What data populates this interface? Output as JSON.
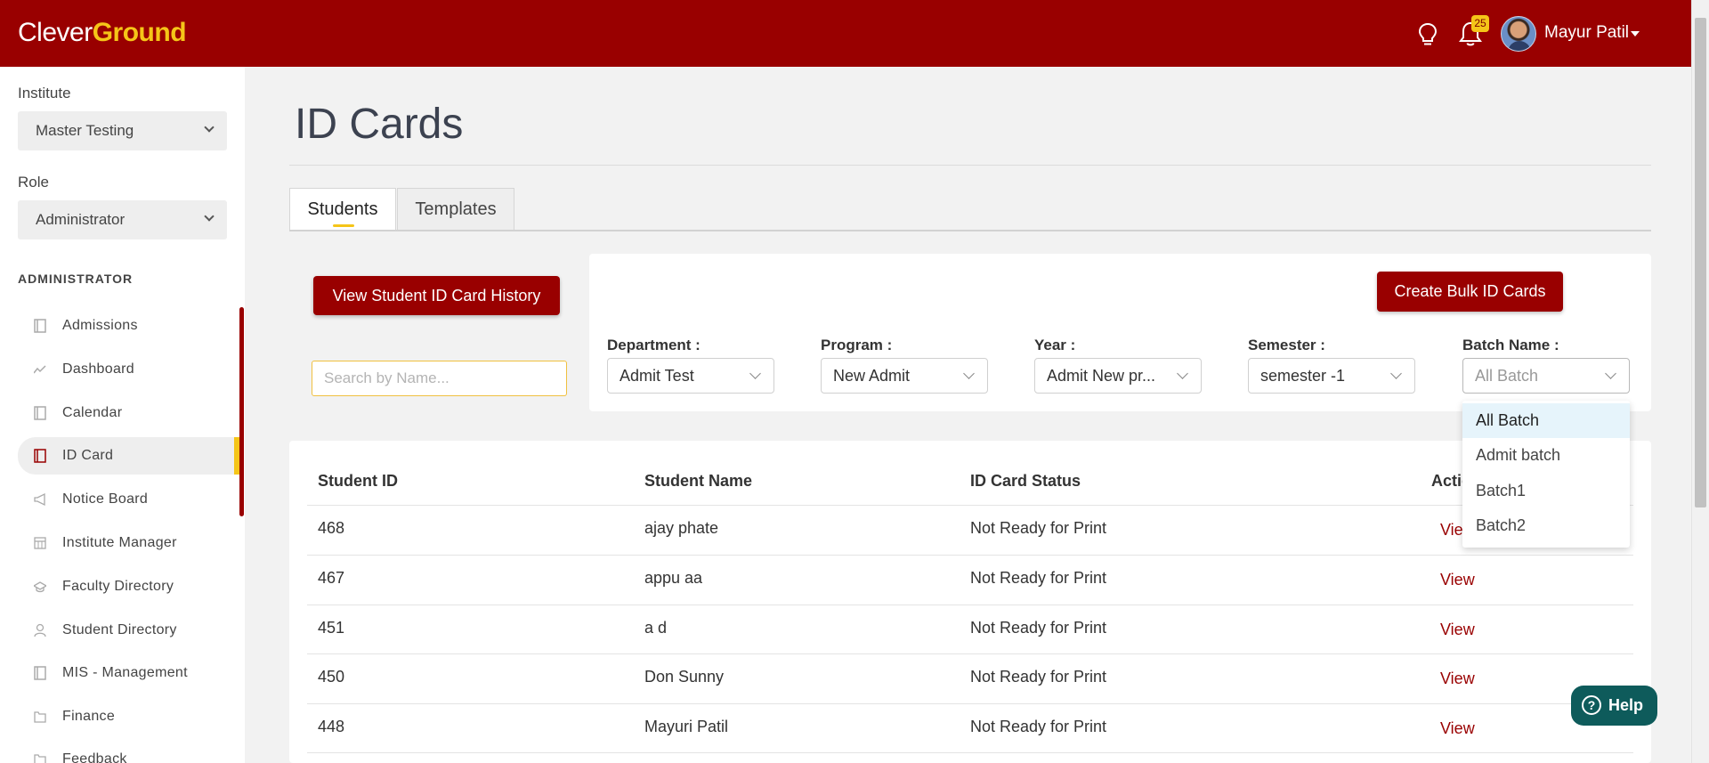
{
  "app": {
    "logo_part1": "Clever",
    "logo_part2": "Ground",
    "notification_count": "25",
    "user_name": "Mayur Patil"
  },
  "sidebar": {
    "institute_label": "Institute",
    "institute_value": "Master Testing",
    "role_label": "Role",
    "role_value": "Administrator",
    "section_title": "ADMINISTRATOR",
    "items": [
      {
        "label": "Admissions",
        "icon": "card-icon"
      },
      {
        "label": "Dashboard",
        "icon": "chart-line-icon"
      },
      {
        "label": "Calendar",
        "icon": "card-icon"
      },
      {
        "label": "ID Card",
        "icon": "card-icon",
        "active": true
      },
      {
        "label": "Notice Board",
        "icon": "megaphone-icon"
      },
      {
        "label": "Institute Manager",
        "icon": "calendar-grid-icon"
      },
      {
        "label": "Faculty Directory",
        "icon": "graduation-cap-icon"
      },
      {
        "label": "Student Directory",
        "icon": "user-icon"
      },
      {
        "label": "MIS - Management",
        "icon": "card-icon"
      },
      {
        "label": "Finance",
        "icon": "folder-icon"
      },
      {
        "label": "Feedback",
        "icon": "folder-icon"
      }
    ]
  },
  "main": {
    "title": "ID Cards",
    "tabs": [
      {
        "label": "Students",
        "active": true
      },
      {
        "label": "Templates",
        "active": false
      }
    ],
    "view_history_button": "View Student ID Card History",
    "search_placeholder": "Search by Name...",
    "create_bulk_button": "Create Bulk ID Cards",
    "filters": [
      {
        "label": "Department :",
        "value": "Admit Test"
      },
      {
        "label": "Program :",
        "value": "New Admit"
      },
      {
        "label": "Year :",
        "value": "Admit New pr..."
      },
      {
        "label": "Semester :",
        "value": "semester -1"
      },
      {
        "label": "Batch Name :",
        "value": "All Batch"
      }
    ],
    "batch_dropdown_options": [
      "All Batch",
      "Admit batch",
      "Batch1",
      "Batch2"
    ],
    "batch_dropdown_selected": "All Batch",
    "table": {
      "headers": [
        "Student ID",
        "Student Name",
        "ID Card Status",
        "Action"
      ],
      "rows": [
        {
          "id": "468",
          "name": "ajay phate",
          "status": "Not Ready for Print",
          "action": "View"
        },
        {
          "id": "467",
          "name": "appu aa",
          "status": "Not Ready for Print",
          "action": "View"
        },
        {
          "id": "451",
          "name": "a d",
          "status": "Not Ready for Print",
          "action": "View"
        },
        {
          "id": "450",
          "name": "Don Sunny",
          "status": "Not Ready for Print",
          "action": "View"
        },
        {
          "id": "448",
          "name": "Mayuri Patil",
          "status": "Not Ready for Print",
          "action": "View"
        }
      ]
    },
    "help_button": "Help"
  },
  "colors": {
    "brand": "#990000",
    "accent": "#f5c518",
    "help": "#0e5b5b"
  }
}
